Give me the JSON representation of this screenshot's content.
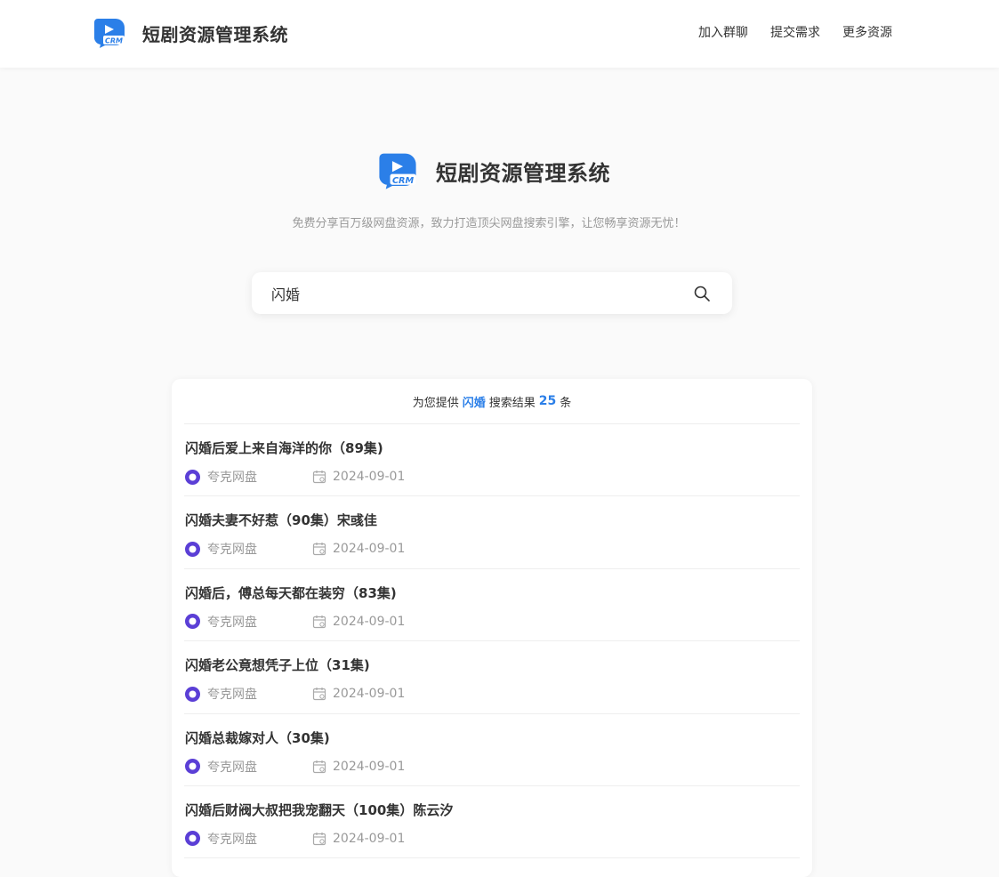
{
  "header": {
    "title": "短剧资源管理系统",
    "logo_text": "CRM",
    "nav": [
      "加入群聊",
      "提交需求",
      "更多资源"
    ]
  },
  "hero": {
    "title": "短剧资源管理系统",
    "logo_text": "CRM",
    "slogan": "免费分享百万级网盘资源，致力打造顶尖网盘搜索引擎，让您畅享资源无忧！"
  },
  "search": {
    "value": "闪婚"
  },
  "summary": {
    "prefix": "为您提供",
    "keyword": "闪婚",
    "middle": "搜索结果",
    "count": "25",
    "suffix": "条"
  },
  "results": [
    {
      "title": "闪婚后爱上来自海洋的你（89集)",
      "source": "夸克网盘",
      "date": "2024-09-01"
    },
    {
      "title": "闪婚夫妻不好惹（90集）宋彧佳",
      "source": "夸克网盘",
      "date": "2024-09-01"
    },
    {
      "title": "闪婚后，傅总每天都在装穷（83集)",
      "source": "夸克网盘",
      "date": "2024-09-01"
    },
    {
      "title": "闪婚老公竟想凭子上位（31集)",
      "source": "夸克网盘",
      "date": "2024-09-01"
    },
    {
      "title": "闪婚总裁嫁对人（30集)",
      "source": "夸克网盘",
      "date": "2024-09-01"
    },
    {
      "title": "闪婚后财阀大叔把我宠翻天（100集）陈云汐",
      "source": "夸克网盘",
      "date": "2024-09-01"
    }
  ],
  "colors": {
    "brand": "#2b7fe8",
    "disk": "#5b3fd6"
  },
  "icons": {
    "logo": "crm-logo-icon",
    "search": "search-icon",
    "disk": "quark-disk-icon",
    "date": "calendar-icon"
  }
}
